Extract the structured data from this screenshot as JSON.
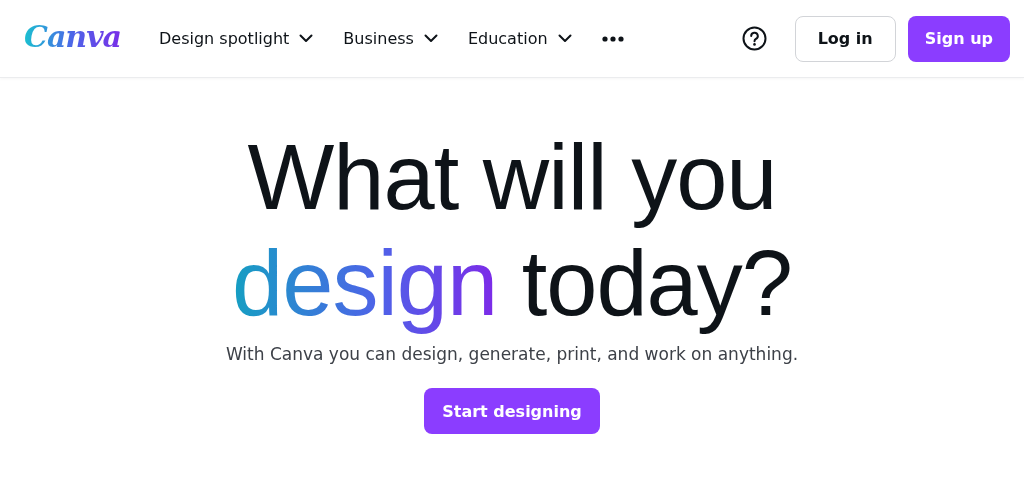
{
  "header": {
    "logo": "Canva",
    "nav": [
      {
        "label": "Design spotlight",
        "dropdown": true
      },
      {
        "label": "Business",
        "dropdown": true
      },
      {
        "label": "Education",
        "dropdown": true
      }
    ],
    "login": "Log in",
    "signup": "Sign up"
  },
  "hero": {
    "line_1": "What will you",
    "highlight": "design",
    "line_2_rest": "today?",
    "subtitle": "With Canva you can design, generate, print, and work on anything.",
    "cta": "Start designing"
  }
}
